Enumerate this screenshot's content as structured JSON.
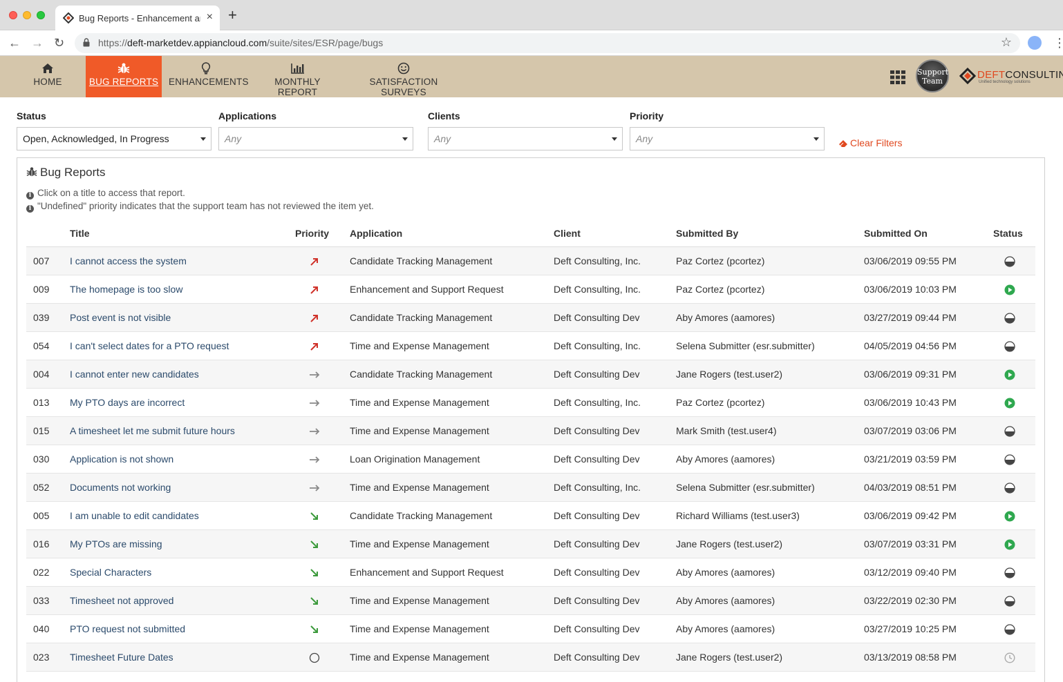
{
  "browser": {
    "tab_title": "Bug Reports - Enhancement and Support Requests",
    "url_scheme": "https://",
    "url_host": "deft-marketdev.appiancloud.com",
    "url_path": "/suite/sites/ESR/page/bugs"
  },
  "nav": {
    "items": [
      {
        "label": "HOME",
        "icon": "home-icon"
      },
      {
        "label": "BUG REPORTS",
        "icon": "bug-icon",
        "active": true
      },
      {
        "label": "ENHANCEMENTS",
        "icon": "lightbulb-icon"
      },
      {
        "label": "MONTHLY REPORT",
        "icon": "bar-chart-icon"
      },
      {
        "label": "SATISFACTION SURVEYS",
        "icon": "smiley-icon"
      }
    ],
    "support_badge_line1": "Support",
    "support_badge_line2": "Team",
    "logo_part1": "DEFT",
    "logo_part2": "CONSULTING",
    "logo_tagline": "Unified technology solutions",
    "active_color": "#f05a28",
    "bar_color": "#d5c6ab"
  },
  "filters": {
    "status_label": "Status",
    "status_value": "Open, Acknowledged, In Progress",
    "applications_label": "Applications",
    "applications_placeholder": "Any",
    "clients_label": "Clients",
    "clients_placeholder": "Any",
    "priority_label": "Priority",
    "priority_placeholder": "Any",
    "clear_label": "Clear Filters"
  },
  "panel": {
    "title": "Bug Reports",
    "note1": "Click on a title to access that report.",
    "note2": "\"Undefined\" priority indicates that the support team has not reviewed the item yet."
  },
  "table": {
    "headers": {
      "title": "Title",
      "priority": "Priority",
      "application": "Application",
      "client": "Client",
      "submitted_by": "Submitted By",
      "submitted_on": "Submitted On",
      "status": "Status"
    },
    "rows": [
      {
        "id": "007",
        "title": "I cannot access the system",
        "priority": "high",
        "application": "Candidate Tracking Management",
        "client": "Deft Consulting, Inc.",
        "submitted_by": "Paz Cortez (pcortez)",
        "submitted_on": "03/06/2019 09:55 PM",
        "status": "acknowledged"
      },
      {
        "id": "009",
        "title": "The homepage is too slow",
        "priority": "high",
        "application": "Enhancement and Support Request",
        "client": "Deft Consulting, Inc.",
        "submitted_by": "Paz Cortez (pcortez)",
        "submitted_on": "03/06/2019 10:03 PM",
        "status": "in-progress"
      },
      {
        "id": "039",
        "title": "Post event is not visible",
        "priority": "high",
        "application": "Candidate Tracking Management",
        "client": "Deft Consulting Dev",
        "submitted_by": "Aby Amores (aamores)",
        "submitted_on": "03/27/2019 09:44 PM",
        "status": "acknowledged"
      },
      {
        "id": "054",
        "title": "I can't select dates for a PTO request",
        "priority": "high",
        "application": "Time and Expense Management",
        "client": "Deft Consulting, Inc.",
        "submitted_by": "Selena Submitter (esr.submitter)",
        "submitted_on": "04/05/2019 04:56 PM",
        "status": "acknowledged"
      },
      {
        "id": "004",
        "title": "I cannot enter new candidates",
        "priority": "medium",
        "application": "Candidate Tracking Management",
        "client": "Deft Consulting Dev",
        "submitted_by": "Jane Rogers (test.user2)",
        "submitted_on": "03/06/2019 09:31 PM",
        "status": "in-progress"
      },
      {
        "id": "013",
        "title": "My PTO days are incorrect",
        "priority": "medium",
        "application": "Time and Expense Management",
        "client": "Deft Consulting, Inc.",
        "submitted_by": "Paz Cortez (pcortez)",
        "submitted_on": "03/06/2019 10:43 PM",
        "status": "in-progress"
      },
      {
        "id": "015",
        "title": "A timesheet let me submit future hours",
        "priority": "medium",
        "application": "Time and Expense Management",
        "client": "Deft Consulting Dev",
        "submitted_by": "Mark Smith (test.user4)",
        "submitted_on": "03/07/2019 03:06 PM",
        "status": "acknowledged"
      },
      {
        "id": "030",
        "title": "Application is not shown",
        "priority": "medium",
        "application": "Loan Origination Management",
        "client": "Deft Consulting Dev",
        "submitted_by": "Aby Amores (aamores)",
        "submitted_on": "03/21/2019 03:59 PM",
        "status": "acknowledged"
      },
      {
        "id": "052",
        "title": "Documents not working",
        "priority": "medium",
        "application": "Time and Expense Management",
        "client": "Deft Consulting, Inc.",
        "submitted_by": "Selena Submitter (esr.submitter)",
        "submitted_on": "04/03/2019 08:51 PM",
        "status": "acknowledged"
      },
      {
        "id": "005",
        "title": "I am unable to edit candidates",
        "priority": "low",
        "application": "Candidate Tracking Management",
        "client": "Deft Consulting Dev",
        "submitted_by": "Richard Williams (test.user3)",
        "submitted_on": "03/06/2019 09:42 PM",
        "status": "in-progress"
      },
      {
        "id": "016",
        "title": "My PTOs are missing",
        "priority": "low",
        "application": "Time and Expense Management",
        "client": "Deft Consulting Dev",
        "submitted_by": "Jane Rogers (test.user2)",
        "submitted_on": "03/07/2019 03:31 PM",
        "status": "in-progress"
      },
      {
        "id": "022",
        "title": "Special Characters",
        "priority": "low",
        "application": "Enhancement and Support Request",
        "client": "Deft Consulting Dev",
        "submitted_by": "Aby Amores (aamores)",
        "submitted_on": "03/12/2019 09:40 PM",
        "status": "acknowledged"
      },
      {
        "id": "033",
        "title": "Timesheet not approved",
        "priority": "low",
        "application": "Time and Expense Management",
        "client": "Deft Consulting Dev",
        "submitted_by": "Aby Amores (aamores)",
        "submitted_on": "03/22/2019 02:30 PM",
        "status": "acknowledged"
      },
      {
        "id": "040",
        "title": "PTO request not submitted",
        "priority": "low",
        "application": "Time and Expense Management",
        "client": "Deft Consulting Dev",
        "submitted_by": "Aby Amores (aamores)",
        "submitted_on": "03/27/2019 10:25 PM",
        "status": "acknowledged"
      },
      {
        "id": "023",
        "title": "Timesheet Future Dates",
        "priority": "undefined",
        "application": "Time and Expense Management",
        "client": "Deft Consulting Dev",
        "submitted_by": "Jane Rogers (test.user2)",
        "submitted_on": "03/13/2019 08:58 PM",
        "status": "open"
      }
    ]
  }
}
